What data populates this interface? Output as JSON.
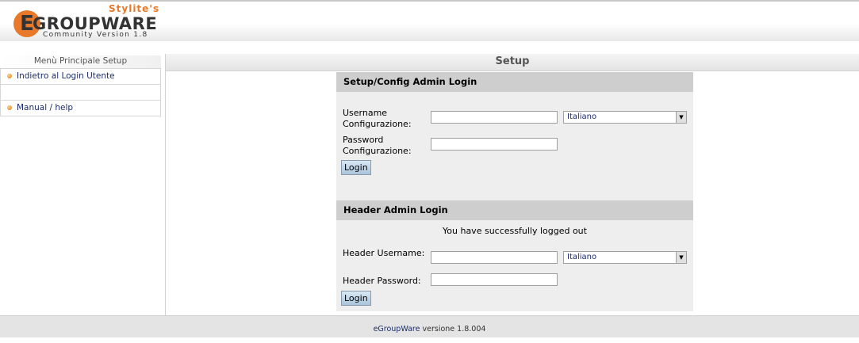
{
  "header": {
    "logo_letter": "E",
    "logo_brand": "GROUPWARE",
    "logo_stylite": "Stylite's",
    "logo_community": "Community Version 1.8"
  },
  "sidebar": {
    "title": "Menù Principale Setup",
    "items": [
      {
        "label": "Indietro al Login Utente"
      },
      {
        "label": "Manual / help"
      }
    ]
  },
  "main": {
    "title": "Setup"
  },
  "config_login": {
    "heading": "Setup/Config Admin Login",
    "username_label": "Username Configurazione:",
    "username_value": "",
    "password_label": "Password Configurazione:",
    "password_value": "",
    "language_selected": "Italiano",
    "login_button": "Login"
  },
  "header_login": {
    "heading": "Header Admin Login",
    "message": "You have successfully logged out",
    "username_label": "Header Username:",
    "username_value": "",
    "password_label": "Header Password:",
    "password_value": "",
    "language_selected": "Italiano",
    "login_button": "Login"
  },
  "footer": {
    "link_text": "eGroupWare",
    "version_text": " versione 1.8.004"
  },
  "colors": {
    "accent_orange": "#e8792a",
    "link_blue": "#1c2d6b",
    "panel_bg": "#eeeeee",
    "section_head_bg": "#cecece"
  }
}
